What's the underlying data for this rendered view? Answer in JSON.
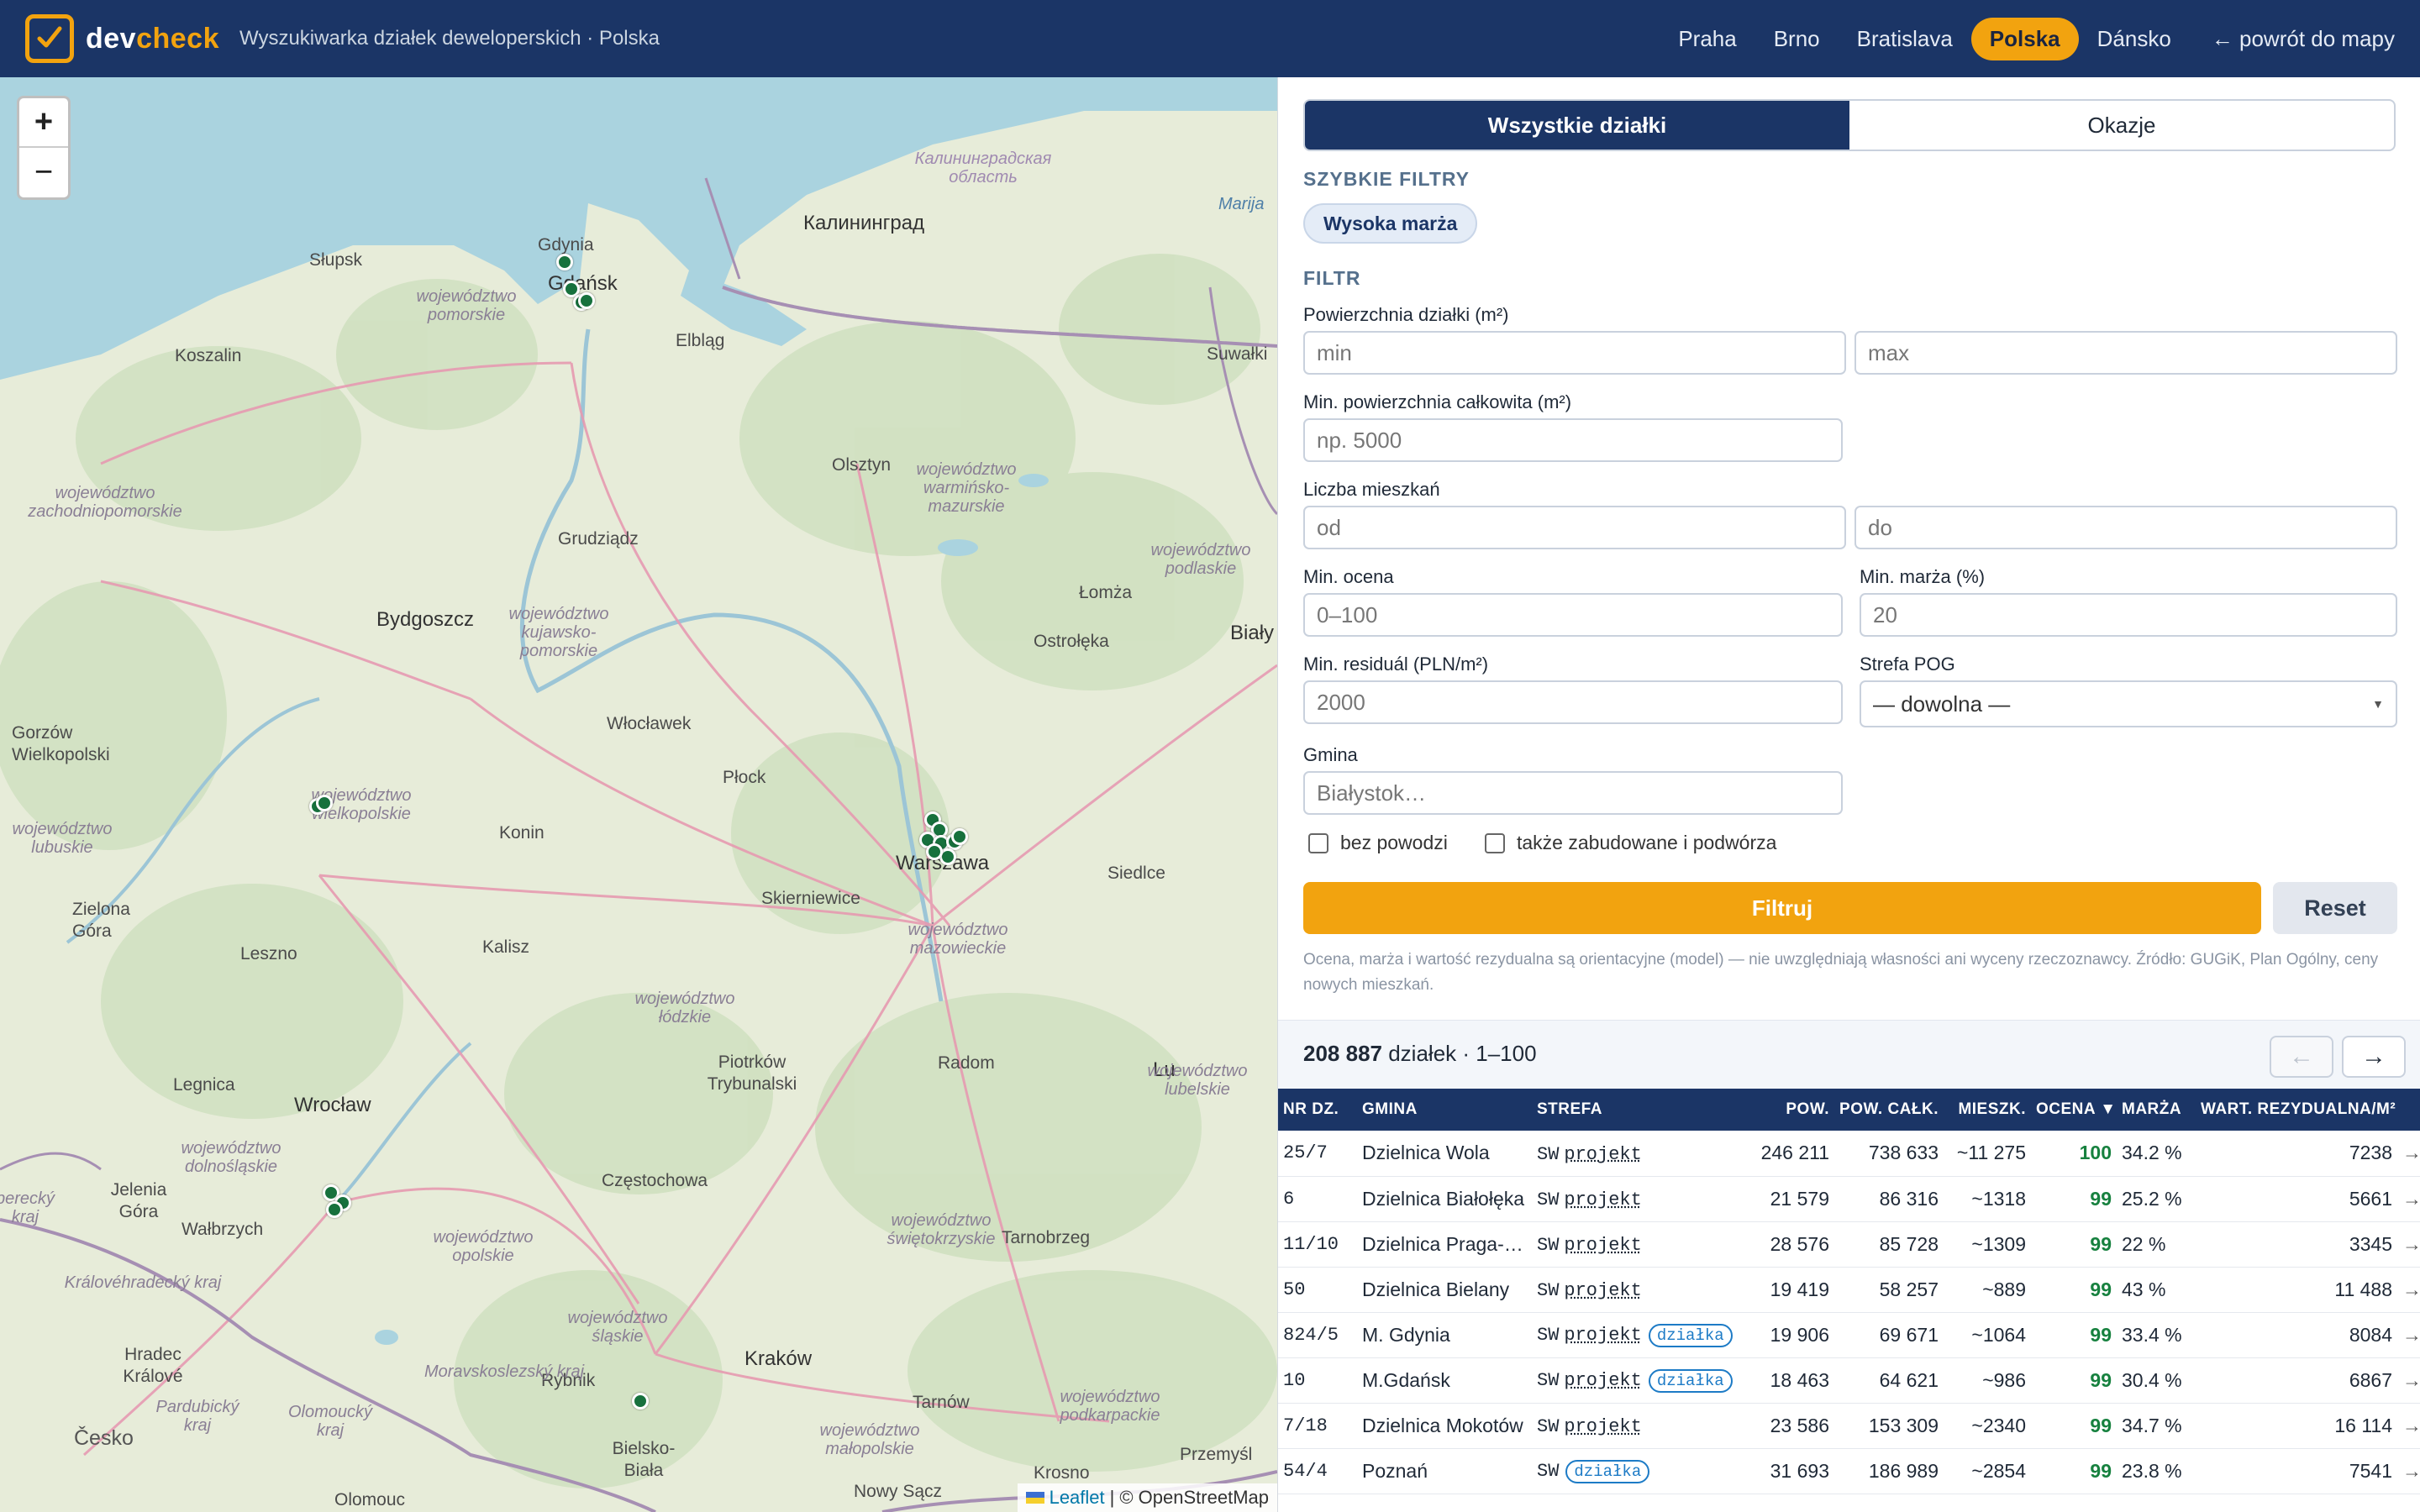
{
  "header": {
    "brand_a": "dev",
    "brand_b": "check",
    "subtitle": "Wyszukiwarka działek deweloperskich · Polska",
    "nav": [
      "Praha",
      "Brno",
      "Bratislava",
      "Polska",
      "Dánsko"
    ],
    "nav_active": "Polska",
    "back": "← powrót do mapy"
  },
  "map": {
    "zoom_in": "+",
    "zoom_out": "−",
    "attribution_link": "Leaflet",
    "attribution_sep": "|",
    "attribution_text": "© OpenStreetMap",
    "places": {
      "gdynia": "Gdynia",
      "gdansk": "Gdańsk",
      "slupsk": "Słupsk",
      "koszalin": "Koszalin",
      "elblag": "Elbląg",
      "kaliningrad": "Калининград",
      "kaliningrad_obl": "Калининградская область",
      "suwalki": "Suwałki",
      "olsztyn": "Olsztyn",
      "grudziadz": "Grudziądz",
      "bydgoszcz": "Bydgoszcz",
      "lomza": "Łomża",
      "ostroleka": "Ostrołęka",
      "bialy": "Biały",
      "wloclawek": "Włocławek",
      "gorzow": "Gorzów Wielkopolski",
      "plock": "Płock",
      "konin": "Konin",
      "warszawa": "Warszawa",
      "siedlce": "Siedlce",
      "zielona_gora": "Zielona Góra",
      "skierniewice": "Skierniewice",
      "leszno": "Leszno",
      "kalisz": "Kalisz",
      "radom": "Radom",
      "piotrkow": "Piotrków Trybunalski",
      "legnica": "Legnica",
      "wroclaw": "Wrocław",
      "jelenia_gora": "Jelenia Góra",
      "walbrzych": "Wałbrzych",
      "czestochowa": "Częstochowa",
      "tarnobrzeg": "Tarnobrzeg",
      "krakow": "Kraków",
      "rybnik": "Rybnik",
      "tarnow": "Tarnów",
      "krosno": "Krosno",
      "przemysl": "Przemyśl",
      "nowy_sacz": "Nowy Sącz",
      "bielsko": "Bielsko-Biała",
      "olomouc": "Olomouc",
      "cesko": "Česko",
      "hradec": "Hradec Králové",
      "pardubicky": "Pardubický kraj",
      "kralovehradecky": "Královéhradecký kraj",
      "olomoucky": "Olomoucký kraj",
      "moravskoslezsky": "Moravskoslezský kraj",
      "liberecky": "berecký kraj",
      "lu": "Lu",
      "marija": "Marija",
      "pomorskie": "województwo pomorskie",
      "zachodniopomorskie": "województwo zachodniopomorskie",
      "warminsko": "województwo warmińsko-mazurskie",
      "podlaskie": "województwo podlaskie",
      "kujawsko": "województwo kujawsko-pomorskie",
      "wielkopolskie": "województwo wielkopolskie",
      "lubuskie": "województwo lubuskie",
      "mazowieckie": "województwo mazowieckie",
      "lodzkie": "województwo łódzkie",
      "dolnoslaskie": "województwo dolnośląskie",
      "opolskie": "województwo opolskie",
      "slaskie": "województwo śląskie",
      "swietokrzyskie": "województwo świętokrzyskie",
      "malopolskie": "województwo małopolskie",
      "podkarpackie": "województwo podkarpackie",
      "lubelskie": "województwo lubelskie"
    }
  },
  "panel": {
    "tabs": [
      "Wszystkie działki",
      "Okazje"
    ],
    "quick_filters_title": "SZYBKIE FILTRY",
    "quick_filter_chip": "Wysoka marża",
    "filter_title": "FILTR",
    "area_label": "Powierzchnia działki (m²)",
    "area_min_ph": "min",
    "area_max_ph": "max",
    "total_area_label": "Min. powierzchnia całkowita (m²)",
    "total_area_ph": "np. 5000",
    "apartments_label": "Liczba mieszkań",
    "apt_from_ph": "od",
    "apt_to_ph": "do",
    "min_score_label": "Min. ocena",
    "min_score_ph": "0–100",
    "min_margin_label": "Min. marża (%)",
    "min_margin_ph": "20",
    "min_residual_label": "Min. residuál (PLN/m²)",
    "min_residual_ph": "2000",
    "zone_label": "Strefa POG",
    "zone_value": "— dowolna —",
    "municipality_label": "Gmina",
    "municipality_ph": "Białystok…",
    "no_flood": "bez powodzi",
    "also_built": "także zabudowane i podwórza",
    "filter_button": "Filtruj",
    "reset_button": "Reset",
    "note": "Ocena, marża i wartość rezydualna są orientacyjne (model) — nie uwzględniają własności ani wyceny rzeczoznawcy. Źródło: GUGiK, Plan Ogólny, ceny nowych mieszkań."
  },
  "results": {
    "count": "208 887",
    "count_suffix": "działek · 1–100",
    "prev": "←",
    "next": "→"
  },
  "table": {
    "headers": [
      "NR DZ.",
      "GMINA",
      "STREFA",
      "POW.",
      "POW. CAŁK.",
      "MIESZK.",
      "OCENA ▼",
      "MARŻA",
      "WART. REZYDUALNA/M²"
    ],
    "rows": [
      {
        "nr": "25/7",
        "gmina": "Dzielnica Wola",
        "zone": "SW",
        "proj": "projekt",
        "tag": "",
        "pow": "246 211",
        "calk": "738 633",
        "mieszk": "~11 275",
        "ocena": "100",
        "marza": "34.2 %",
        "wart": "7238",
        "go": "→"
      },
      {
        "nr": "6",
        "gmina": "Dzielnica Białołęka",
        "zone": "SW",
        "proj": "projekt",
        "tag": "",
        "pow": "21 579",
        "calk": "86 316",
        "mieszk": "~1318",
        "ocena": "99",
        "marza": "25.2 %",
        "wart": "5661",
        "go": "→"
      },
      {
        "nr": "11/10",
        "gmina": "Dzielnica Praga-Południe",
        "zone": "SW",
        "proj": "projekt",
        "tag": "",
        "pow": "28 576",
        "calk": "85 728",
        "mieszk": "~1309",
        "ocena": "99",
        "marza": "22 %",
        "wart": "3345",
        "go": "→"
      },
      {
        "nr": "50",
        "gmina": "Dzielnica Bielany",
        "zone": "SW",
        "proj": "projekt",
        "tag": "",
        "pow": "19 419",
        "calk": "58 257",
        "mieszk": "~889",
        "ocena": "99",
        "marza": "43 %",
        "wart": "11 488",
        "go": "→"
      },
      {
        "nr": "824/5",
        "gmina": "M. Gdynia",
        "zone": "SW",
        "proj": "projekt",
        "tag": "działka",
        "pow": "19 906",
        "calk": "69 671",
        "mieszk": "~1064",
        "ocena": "99",
        "marza": "33.4 %",
        "wart": "8084",
        "go": "→"
      },
      {
        "nr": "10",
        "gmina": "M.Gdańsk",
        "zone": "SW",
        "proj": "projekt",
        "tag": "działka",
        "pow": "18 463",
        "calk": "64 621",
        "mieszk": "~986",
        "ocena": "99",
        "marza": "30.4 %",
        "wart": "6867",
        "go": "→"
      },
      {
        "nr": "7/18",
        "gmina": "Dzielnica Mokotów",
        "zone": "SW",
        "proj": "projekt",
        "tag": "",
        "pow": "23 586",
        "calk": "153 309",
        "mieszk": "~2340",
        "ocena": "99",
        "marza": "34.7 %",
        "wart": "16 114",
        "go": "→"
      },
      {
        "nr": "54/4",
        "gmina": "Poznań",
        "zone": "SW",
        "proj": "",
        "tag": "działka",
        "pow": "31 693",
        "calk": "186 989",
        "mieszk": "~2854",
        "ocena": "99",
        "marza": "23.8 %",
        "wart": "7541",
        "go": "→"
      }
    ]
  },
  "colors": {
    "header_bg": "#1b3566",
    "accent": "#f2a30f",
    "score_green": "#17813f",
    "marker_green": "#17713d",
    "tag_blue": "#1d7bc6"
  }
}
